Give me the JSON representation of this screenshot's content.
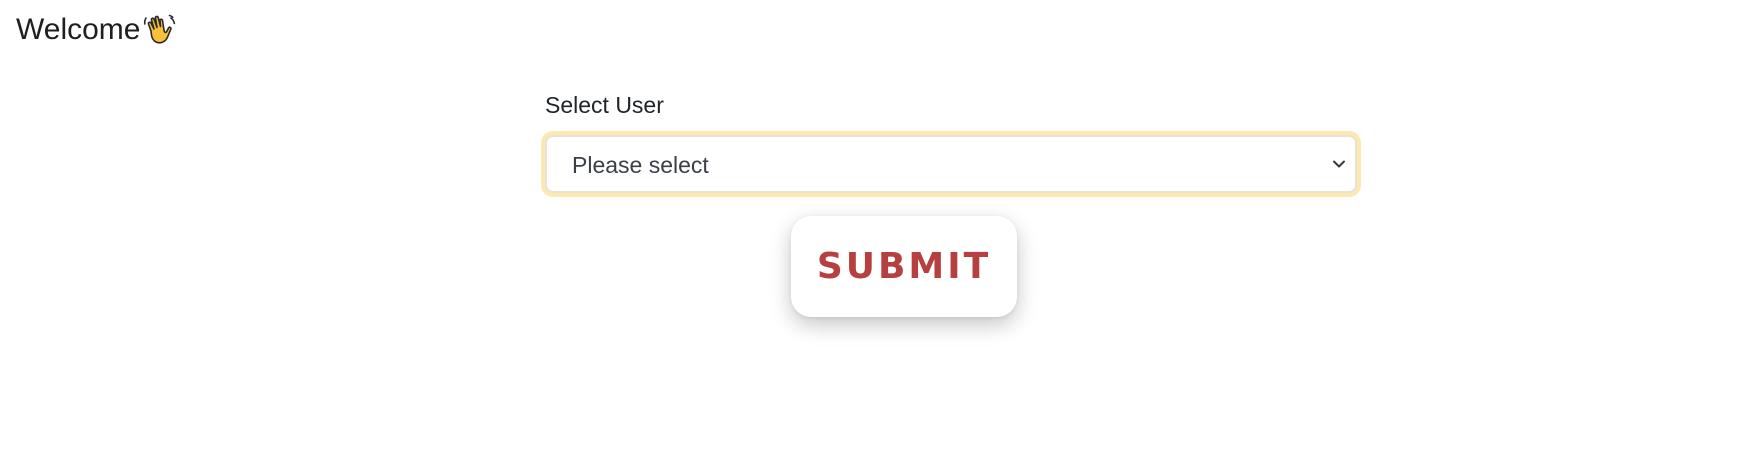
{
  "header": {
    "welcome_text": "Welcome",
    "wave_icon": "waving-hand-icon"
  },
  "form": {
    "label": "Select User",
    "select": {
      "selected_value": "Please select",
      "chevron_icon": "chevron-down-icon"
    },
    "submit_label": "SUBMIT"
  },
  "colors": {
    "submit_text": "#b5403f",
    "focus_ring": "#fde9b0",
    "wave_fill": "#f7c23a"
  }
}
